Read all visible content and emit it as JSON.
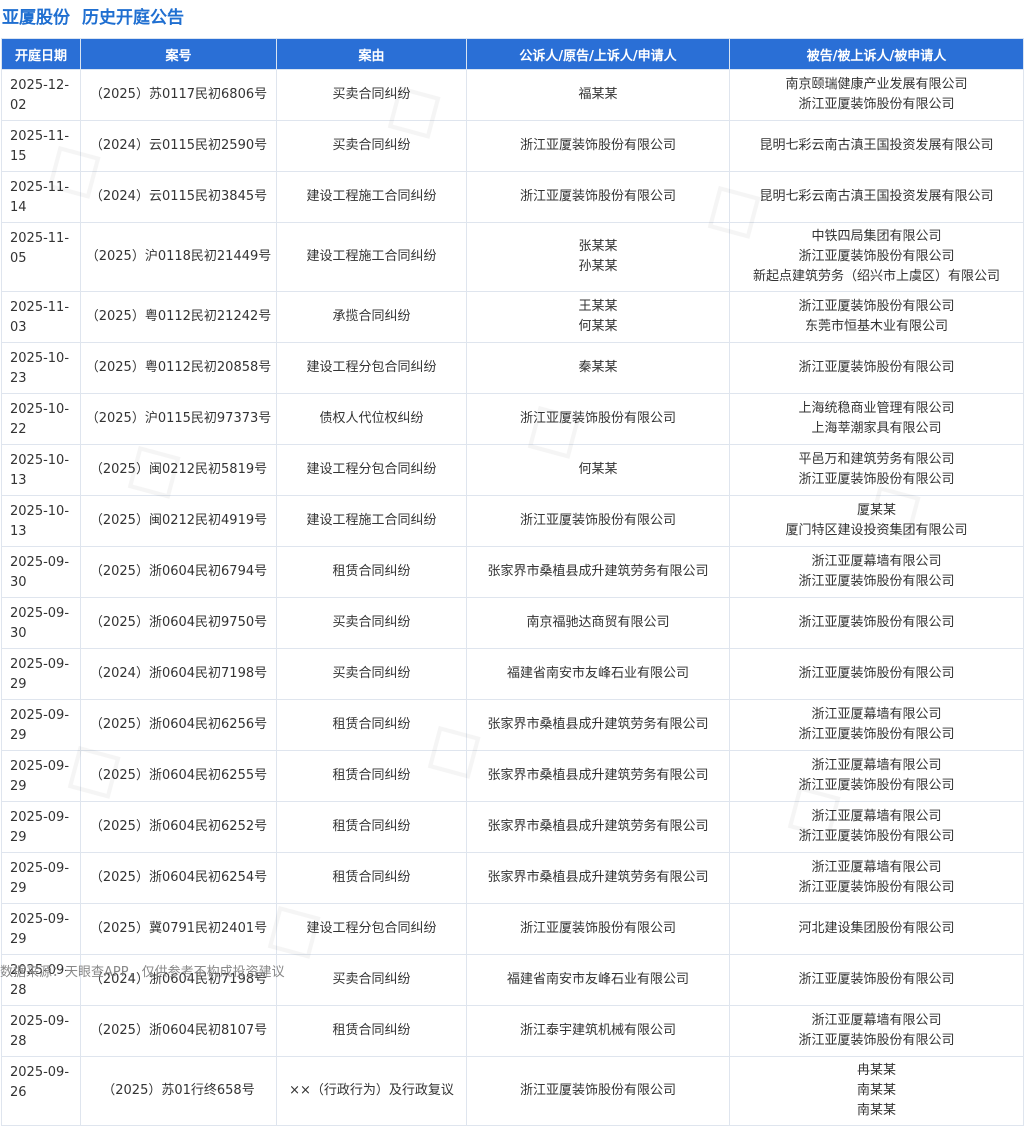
{
  "header": {
    "company": "亚厦股份",
    "title": "历史开庭公告"
  },
  "columns": [
    "开庭日期",
    "案号",
    "案由",
    "公诉人/原告/上诉人/申请人",
    "被告/被上诉人/被申请人"
  ],
  "rows": [
    {
      "date": "2025-12-02",
      "case_no": "（2025）苏0117民初6806号",
      "cause": "买卖合同纠纷",
      "plaintiffs": [
        "福某某"
      ],
      "defendants": [
        "南京颐瑞健康产业发展有限公司",
        "浙江亚厦装饰股份有限公司"
      ]
    },
    {
      "date": "2025-11-15",
      "case_no": "（2024）云0115民初2590号",
      "cause": "买卖合同纠纷",
      "plaintiffs": [
        "浙江亚厦装饰股份有限公司"
      ],
      "defendants": [
        "昆明七彩云南古滇王国投资发展有限公司"
      ]
    },
    {
      "date": "2025-11-14",
      "case_no": "（2024）云0115民初3845号",
      "cause": "建设工程施工合同纠纷",
      "plaintiffs": [
        "浙江亚厦装饰股份有限公司"
      ],
      "defendants": [
        "昆明七彩云南古滇王国投资发展有限公司"
      ]
    },
    {
      "date": "2025-11-05",
      "case_no": "（2025）沪0118民初21449号",
      "cause": "建设工程施工合同纠纷",
      "plaintiffs": [
        "张某某",
        "孙某某"
      ],
      "defendants": [
        "中铁四局集团有限公司",
        "浙江亚厦装饰股份有限公司",
        "新起点建筑劳务（绍兴市上虞区）有限公司"
      ]
    },
    {
      "date": "2025-11-03",
      "case_no": "（2025）粤0112民初21242号",
      "cause": "承揽合同纠纷",
      "plaintiffs": [
        "王某某",
        "何某某"
      ],
      "defendants": [
        "浙江亚厦装饰股份有限公司",
        "东莞市恒基木业有限公司"
      ]
    },
    {
      "date": "2025-10-23",
      "case_no": "（2025）粤0112民初20858号",
      "cause": "建设工程分包合同纠纷",
      "plaintiffs": [
        "秦某某"
      ],
      "defendants": [
        "浙江亚厦装饰股份有限公司"
      ]
    },
    {
      "date": "2025-10-22",
      "case_no": "（2025）沪0115民初97373号",
      "cause": "债权人代位权纠纷",
      "plaintiffs": [
        "浙江亚厦装饰股份有限公司"
      ],
      "defendants": [
        "上海统稳商业管理有限公司",
        "上海莘潮家具有限公司"
      ]
    },
    {
      "date": "2025-10-13",
      "case_no": "（2025）闽0212民初5819号",
      "cause": "建设工程分包合同纠纷",
      "plaintiffs": [
        "何某某"
      ],
      "defendants": [
        "平邑万和建筑劳务有限公司",
        "浙江亚厦装饰股份有限公司"
      ]
    },
    {
      "date": "2025-10-13",
      "case_no": "（2025）闽0212民初4919号",
      "cause": "建设工程施工合同纠纷",
      "plaintiffs": [
        "浙江亚厦装饰股份有限公司"
      ],
      "defendants": [
        "厦某某",
        "厦门特区建设投资集团有限公司"
      ]
    },
    {
      "date": "2025-09-30",
      "case_no": "（2025）浙0604民初6794号",
      "cause": "租赁合同纠纷",
      "plaintiffs": [
        "张家界市桑植县成升建筑劳务有限公司"
      ],
      "defendants": [
        "浙江亚厦幕墙有限公司",
        "浙江亚厦装饰股份有限公司"
      ]
    },
    {
      "date": "2025-09-30",
      "case_no": "（2025）浙0604民初9750号",
      "cause": "买卖合同纠纷",
      "plaintiffs": [
        "南京福驰达商贸有限公司"
      ],
      "defendants": [
        "浙江亚厦装饰股份有限公司"
      ]
    },
    {
      "date": "2025-09-29",
      "case_no": "（2024）浙0604民初7198号",
      "cause": "买卖合同纠纷",
      "plaintiffs": [
        "福建省南安市友峰石业有限公司"
      ],
      "defendants": [
        "浙江亚厦装饰股份有限公司"
      ]
    },
    {
      "date": "2025-09-29",
      "case_no": "（2025）浙0604民初6256号",
      "cause": "租赁合同纠纷",
      "plaintiffs": [
        "张家界市桑植县成升建筑劳务有限公司"
      ],
      "defendants": [
        "浙江亚厦幕墙有限公司",
        "浙江亚厦装饰股份有限公司"
      ]
    },
    {
      "date": "2025-09-29",
      "case_no": "（2025）浙0604民初6255号",
      "cause": "租赁合同纠纷",
      "plaintiffs": [
        "张家界市桑植县成升建筑劳务有限公司"
      ],
      "defendants": [
        "浙江亚厦幕墙有限公司",
        "浙江亚厦装饰股份有限公司"
      ]
    },
    {
      "date": "2025-09-29",
      "case_no": "（2025）浙0604民初6252号",
      "cause": "租赁合同纠纷",
      "plaintiffs": [
        "张家界市桑植县成升建筑劳务有限公司"
      ],
      "defendants": [
        "浙江亚厦幕墙有限公司",
        "浙江亚厦装饰股份有限公司"
      ]
    },
    {
      "date": "2025-09-29",
      "case_no": "（2025）浙0604民初6254号",
      "cause": "租赁合同纠纷",
      "plaintiffs": [
        "张家界市桑植县成升建筑劳务有限公司"
      ],
      "defendants": [
        "浙江亚厦幕墙有限公司",
        "浙江亚厦装饰股份有限公司"
      ]
    },
    {
      "date": "2025-09-29",
      "case_no": "（2025）冀0791民初2401号",
      "cause": "建设工程分包合同纠纷",
      "plaintiffs": [
        "浙江亚厦装饰股份有限公司"
      ],
      "defendants": [
        "河北建设集团股份有限公司"
      ]
    },
    {
      "date": "2025-09-28",
      "case_no": "（2024）浙0604民初7198号",
      "cause": "买卖合同纠纷",
      "plaintiffs": [
        "福建省南安市友峰石业有限公司"
      ],
      "defendants": [
        "浙江亚厦装饰股份有限公司"
      ]
    },
    {
      "date": "2025-09-28",
      "case_no": "（2025）浙0604民初8107号",
      "cause": "租赁合同纠纷",
      "plaintiffs": [
        "浙江泰宇建筑机械有限公司"
      ],
      "defendants": [
        "浙江亚厦幕墙有限公司",
        "浙江亚厦装饰股份有限公司"
      ]
    },
    {
      "date": "2025-09-26",
      "case_no": "（2025）苏01行终658号",
      "cause": "××（行政行为）及行政复议",
      "plaintiffs": [
        "浙江亚厦装饰股份有限公司"
      ],
      "defendants": [
        "冉某某",
        "南某某",
        "南某某"
      ]
    }
  ],
  "footer": {
    "source": "数据来源：天眼查APP，仅供参考不构成投资建议"
  },
  "colors": {
    "header_text": "#1f6fd1",
    "table_header_bg": "#2a6fd6",
    "border": "#dfe5ee"
  }
}
